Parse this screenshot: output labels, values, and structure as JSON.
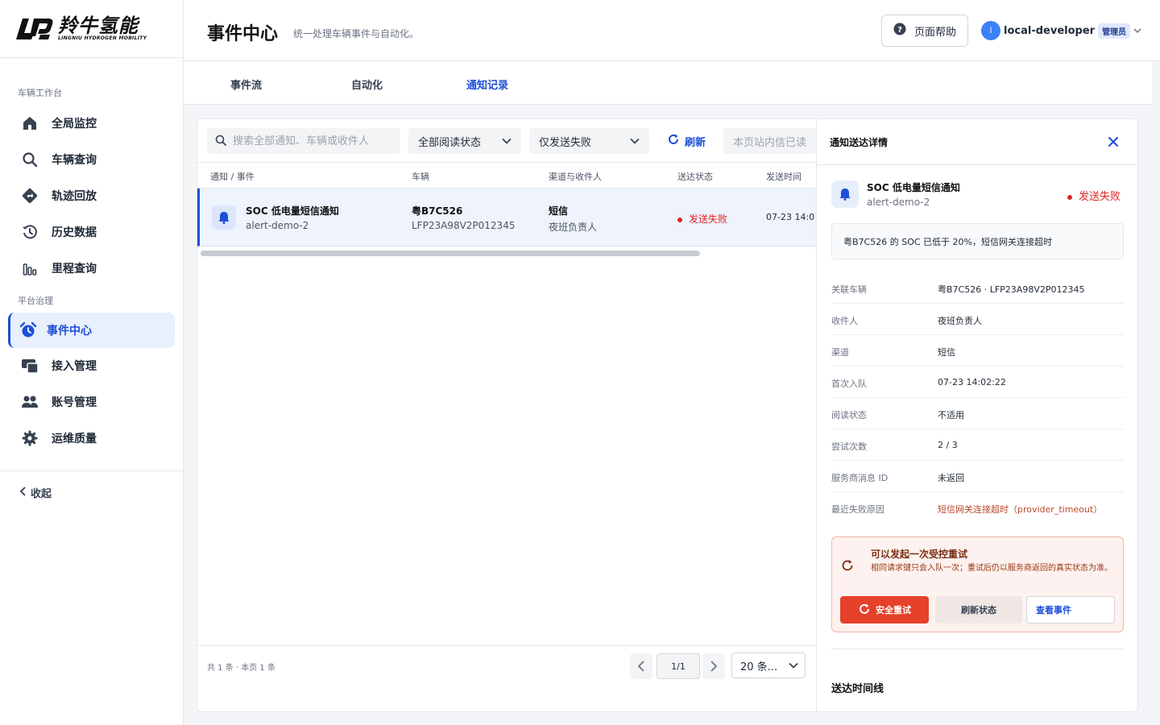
{
  "brand": {
    "name_cn": "羚牛氢能",
    "name_en": "LINGNIU HYDROGEN MOBILITY"
  },
  "sidebar": {
    "sections": [
      {
        "label": "车辆工作台"
      },
      {
        "label": "平台治理"
      }
    ],
    "items": [
      {
        "label": "全局监控",
        "icon": "home-icon"
      },
      {
        "label": "车辆查询",
        "icon": "search-icon"
      },
      {
        "label": "轨迹回放",
        "icon": "route-icon"
      },
      {
        "label": "历史数据",
        "icon": "history-icon"
      },
      {
        "label": "里程查询",
        "icon": "bar-chart-icon"
      },
      {
        "label": "事件中心",
        "icon": "alarm-clock-icon",
        "active": true
      },
      {
        "label": "接入管理",
        "icon": "devices-icon"
      },
      {
        "label": "账号管理",
        "icon": "users-icon"
      },
      {
        "label": "运维质量",
        "icon": "gear-icon"
      }
    ],
    "collapse_label": "收起"
  },
  "header": {
    "title": "事件中心",
    "subtitle": "统一处理车辆事件与自动化。",
    "help_label": "页面帮助",
    "user": {
      "avatar_initial": "l",
      "name": "local-developer",
      "role": "管理员"
    }
  },
  "tabs": [
    {
      "label": "事件流"
    },
    {
      "label": "自动化"
    },
    {
      "label": "通知记录",
      "active": true
    }
  ],
  "filters": {
    "search_placeholder": "搜索全部通知、车辆或收件人",
    "read_state": "全部阅读状态",
    "send_state": "仅发送失败",
    "refresh_label": "刷新",
    "disabled_action": "本页站内信已读"
  },
  "table": {
    "columns": [
      "通知 / 事件",
      "车辆",
      "渠道与收件人",
      "送达状态",
      "发送时间"
    ],
    "rows": [
      {
        "title": "SOC 低电量短信通知",
        "event_id": "alert-demo-2",
        "plate": "粤B7C526",
        "vin": "LFP23A98V2P012345",
        "channel": "短信",
        "recipient": "夜班负责人",
        "status": "发送失败",
        "sent_time": "07-23 14:0"
      }
    ]
  },
  "pagination": {
    "summary": "共 1 条 · 本页 1 条",
    "page": "1/1",
    "page_size": "20 条..."
  },
  "detail": {
    "title": "通知送达详情",
    "event_title": "SOC 低电量短信通知",
    "event_id": "alert-demo-2",
    "status": "发送失败",
    "message": "粤B7C526 的 SOC 已低于 20%，短信网关连接超时",
    "fields": [
      {
        "key": "关联车辆",
        "value": "粤B7C526 · LFP23A98V2P012345"
      },
      {
        "key": "收件人",
        "value": "夜班负责人"
      },
      {
        "key": "渠道",
        "value": "短信"
      },
      {
        "key": "首次入队",
        "value": "07-23 14:02:22"
      },
      {
        "key": "阅读状态",
        "value": "不适用"
      },
      {
        "key": "尝试次数",
        "value": "2 / 3"
      },
      {
        "key": "服务商消息 ID",
        "value": "未返回"
      },
      {
        "key": "最近失败原因",
        "value": "短信网关连接超时（provider_timeout）",
        "error": true
      }
    ],
    "retry": {
      "title": "可以发起一次受控重试",
      "description": "相同请求键只会入队一次；重试后仍以服务商返回的真实状态为准。",
      "retry_label": "安全重试",
      "refresh_label": "刷新状态",
      "view_label": "查看事件"
    },
    "timeline_title": "送达时间线"
  },
  "colors": {
    "accent": "#1d4ed8",
    "error": "#dc2626",
    "retry_button": "#e5412b"
  }
}
